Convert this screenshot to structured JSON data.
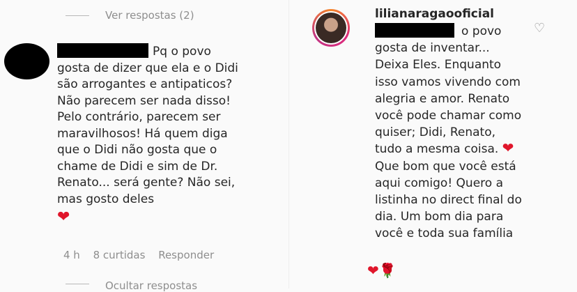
{
  "thread": {
    "view_replies": "Ver respostas (2)",
    "hide_replies": "Ocultar respostas"
  },
  "comment_left": {
    "text": "Pq o povo gosta de dizer que ela e o Didi são arrogantes e antipaticos? Não parecem ser nada disso! Pelo contrário, parecem ser maravilhosos! Há quem diga que o Didi não gosta que o chame de Didi e sim de Dr. Renato... será gente? Não sei, mas gosto deles",
    "emoji": "❤",
    "time": "4 h",
    "likes": "8 curtidas",
    "reply": "Responder"
  },
  "comment_right": {
    "username": "lilianaragaooficial",
    "text": "o povo gosta de inventar... Deixa Eles. Enquanto isso vamos vivendo com alegria e amor. Renato você pode chamar como quiser; Didi, Renato, tudo a mesma coisa.",
    "emoji_mid": "❤",
    "text2": "Que bom que você está aqui comigo! Quero a listinha no direct final do dia. Um bom dia para você e toda sua família",
    "emoji_end_heart": "❤",
    "emoji_end_rose": "🌹",
    "like_icon": "♡"
  },
  "colors": {
    "muted": "#8e8e8e",
    "heart": "#e0162b",
    "text": "#262626"
  }
}
